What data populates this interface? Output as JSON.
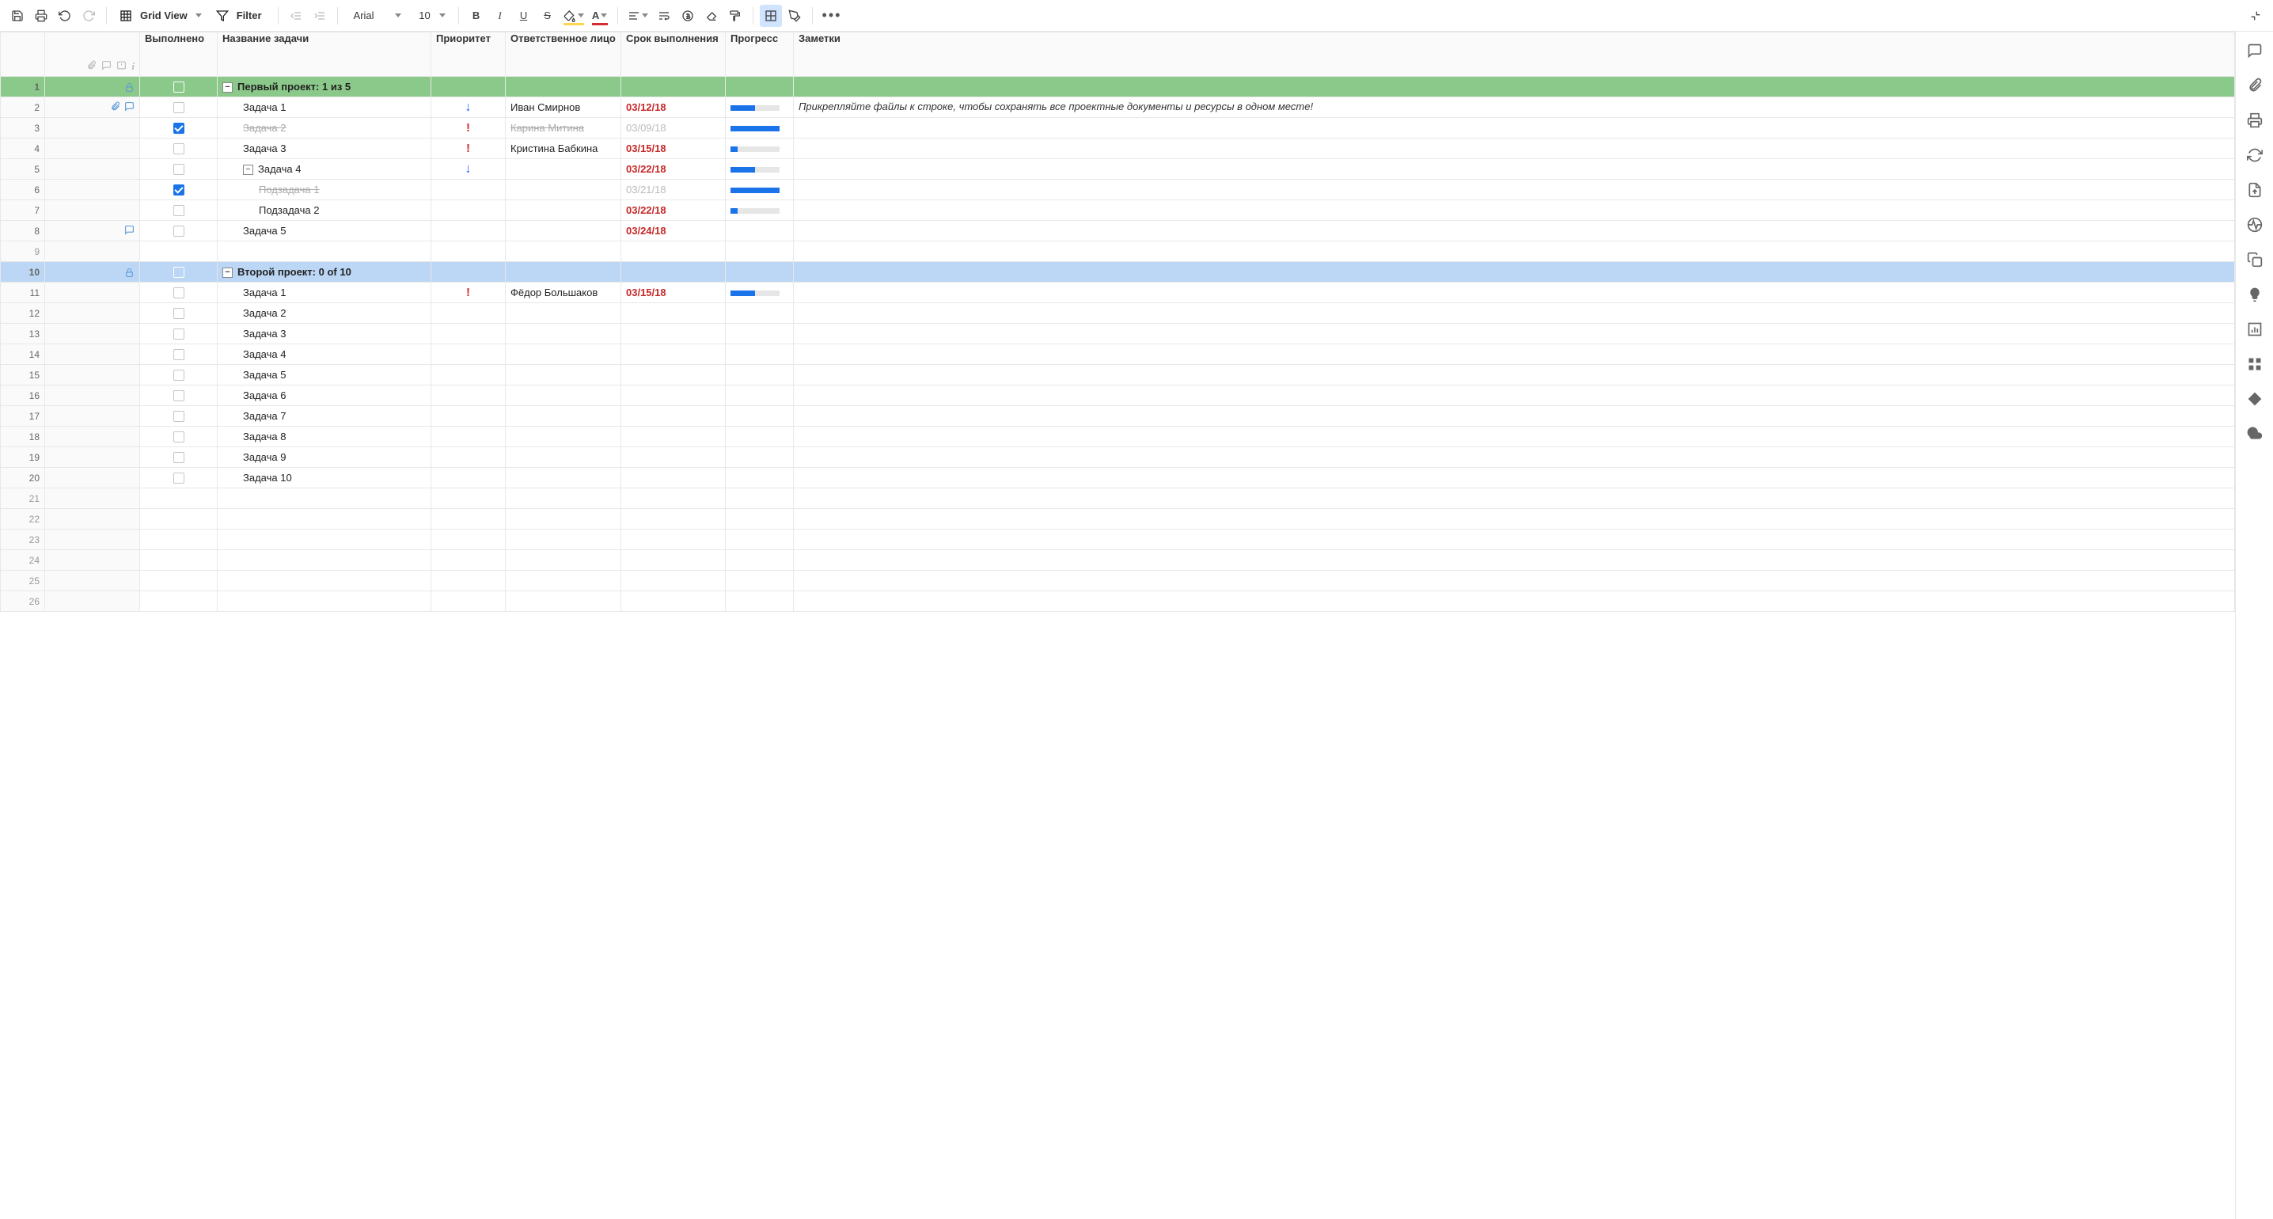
{
  "toolbar": {
    "grid_view": "Grid View",
    "filter": "Filter",
    "font": "Arial",
    "font_size": "10"
  },
  "columns": {
    "done": "Выполнено",
    "name": "Название задачи",
    "priority": "Приоритет",
    "responsible": "Ответственное лицо",
    "due": "Срок выполнения",
    "progress": "Прогресс",
    "notes": "Заметки"
  },
  "rows": [
    {
      "n": 1,
      "type": "section",
      "color": "green",
      "lock": true,
      "name": "Первый проект: 1 из 5"
    },
    {
      "n": 2,
      "type": "task",
      "attach": [
        "clip",
        "bubble"
      ],
      "checked": false,
      "indent": 1,
      "name": "Задача 1",
      "pri": "down",
      "resp": "Иван Смирнов",
      "due": "03/12/18",
      "prog": 50,
      "notes": "Прикрепляйте файлы к строке, чтобы сохранять все проектные документы и ресурсы в одном месте!"
    },
    {
      "n": 3,
      "type": "task",
      "checked": true,
      "indent": 1,
      "name": "Задача 2",
      "strike": true,
      "pri": "bang",
      "resp": "Карина Митина",
      "resp_muted": true,
      "due": "03/09/18",
      "due_muted": true,
      "prog": 100
    },
    {
      "n": 4,
      "type": "task",
      "checked": false,
      "indent": 1,
      "name": "Задача 3",
      "pri": "bang",
      "resp": "Кристина Бабкина",
      "due": "03/15/18",
      "prog": 15
    },
    {
      "n": 5,
      "type": "task",
      "checked": false,
      "indent": 1,
      "name": "Задача 4",
      "collapse": true,
      "pri": "down",
      "due": "03/22/18",
      "prog": 50
    },
    {
      "n": 6,
      "type": "task",
      "checked": true,
      "indent": 2,
      "name": "Подзадача 1",
      "strike": true,
      "due": "03/21/18",
      "due_muted": true,
      "prog": 100
    },
    {
      "n": 7,
      "type": "task",
      "checked": false,
      "indent": 2,
      "name": "Подзадача 2",
      "due": "03/22/18",
      "prog": 15
    },
    {
      "n": 8,
      "type": "task",
      "attach": [
        "bubble"
      ],
      "checked": false,
      "indent": 1,
      "name": "Задача 5",
      "due": "03/24/18"
    },
    {
      "n": 9,
      "type": "empty"
    },
    {
      "n": 10,
      "type": "section",
      "color": "blue",
      "lock": true,
      "name": "Второй проект: 0 of 10"
    },
    {
      "n": 11,
      "type": "task",
      "checked": false,
      "indent": 1,
      "name": "Задача 1",
      "pri": "bang",
      "resp": "Фёдор Большаков",
      "due": "03/15/18",
      "prog": 50
    },
    {
      "n": 12,
      "type": "task",
      "checked": false,
      "indent": 1,
      "name": "Задача 2"
    },
    {
      "n": 13,
      "type": "task",
      "checked": false,
      "indent": 1,
      "name": "Задача 3"
    },
    {
      "n": 14,
      "type": "task",
      "checked": false,
      "indent": 1,
      "name": "Задача 4"
    },
    {
      "n": 15,
      "type": "task",
      "checked": false,
      "indent": 1,
      "name": "Задача 5"
    },
    {
      "n": 16,
      "type": "task",
      "checked": false,
      "indent": 1,
      "name": "Задача 6"
    },
    {
      "n": 17,
      "type": "task",
      "checked": false,
      "indent": 1,
      "name": "Задача 7"
    },
    {
      "n": 18,
      "type": "task",
      "checked": false,
      "indent": 1,
      "name": "Задача 8"
    },
    {
      "n": 19,
      "type": "task",
      "checked": false,
      "indent": 1,
      "name": "Задача 9"
    },
    {
      "n": 20,
      "type": "task",
      "checked": false,
      "indent": 1,
      "name": "Задача 10"
    },
    {
      "n": 21,
      "type": "empty"
    },
    {
      "n": 22,
      "type": "empty"
    },
    {
      "n": 23,
      "type": "empty"
    },
    {
      "n": 24,
      "type": "empty"
    },
    {
      "n": 25,
      "type": "empty"
    },
    {
      "n": 26,
      "type": "empty"
    }
  ]
}
